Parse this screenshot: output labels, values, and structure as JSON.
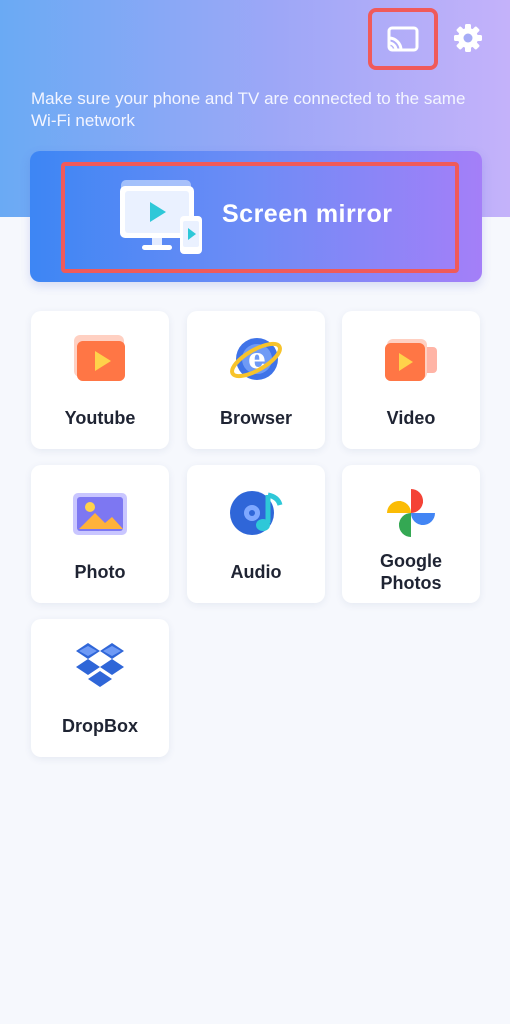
{
  "header": {
    "subtitle": "Make sure your phone and TV are connected to the same Wi-Fi network",
    "cast_icon": "cast-icon",
    "settings_icon": "gear-icon"
  },
  "mirror": {
    "label": "Screen mirror",
    "icon": "screen-mirror-icon"
  },
  "tiles": [
    {
      "label": "Youtube",
      "icon": "youtube-icon"
    },
    {
      "label": "Browser",
      "icon": "browser-icon"
    },
    {
      "label": "Video",
      "icon": "video-icon"
    },
    {
      "label": "Photo",
      "icon": "photo-icon"
    },
    {
      "label": "Audio",
      "icon": "audio-icon"
    },
    {
      "label": "Google Photos",
      "icon": "google-photos-icon"
    },
    {
      "label": "DropBox",
      "icon": "dropbox-icon"
    }
  ],
  "colors": {
    "highlight": "#f05a5a",
    "gradient_start": "#3d86f4",
    "gradient_end": "#a47ff8"
  }
}
